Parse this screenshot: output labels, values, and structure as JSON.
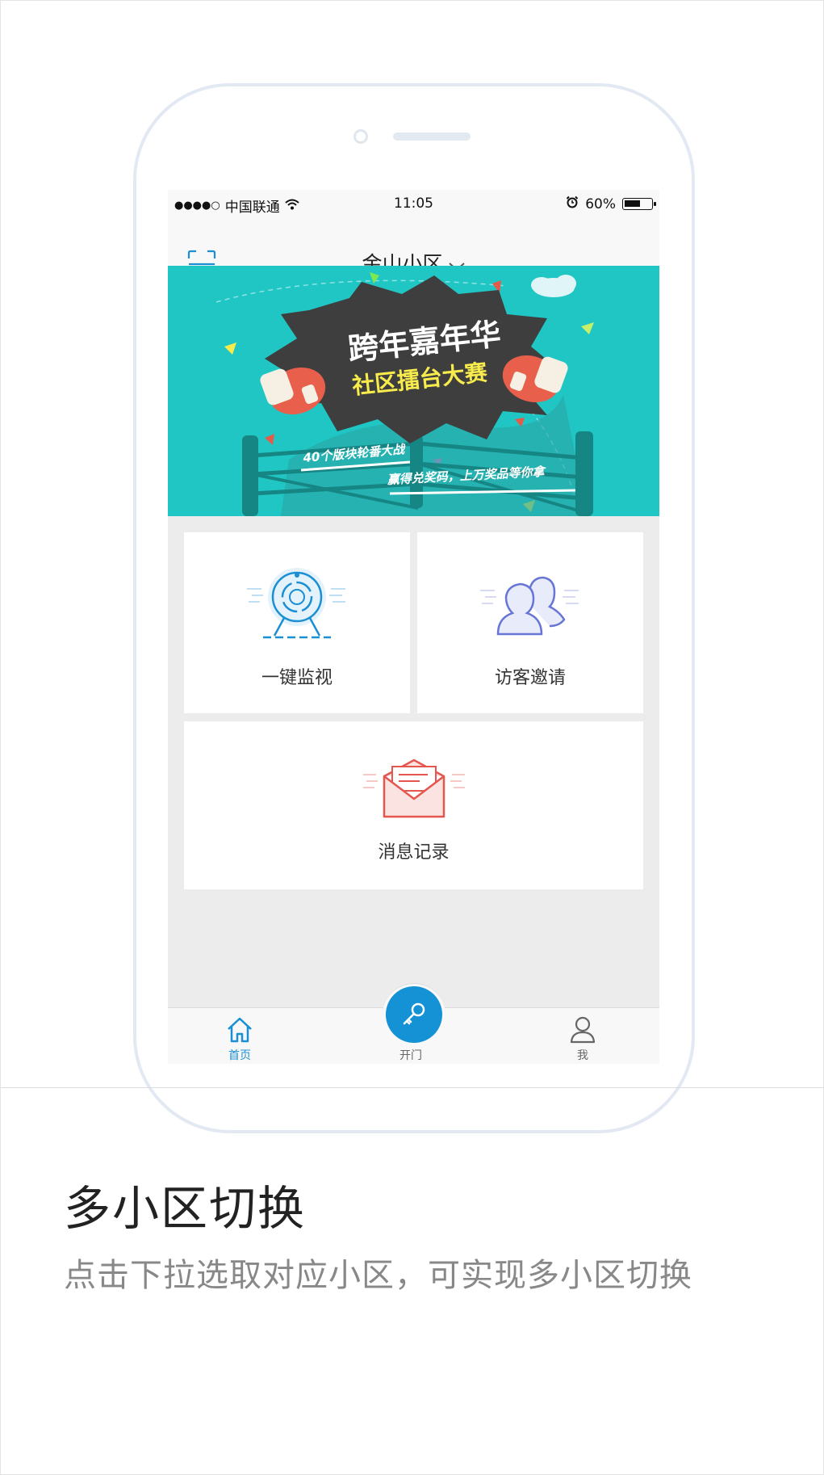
{
  "statusbar": {
    "signal": "●●●●○",
    "carrier": "中国联通",
    "time": "11:05",
    "battery_text": "60%",
    "battery_level": 0.6
  },
  "navbar": {
    "community": "金山小区"
  },
  "banner": {
    "title_line1": "跨年嘉年华",
    "title_line2": "社区擂台大赛",
    "tagline1": "40个版块轮番大战",
    "tagline2": "赢得兑奖码，上万奖品等你拿"
  },
  "tiles": {
    "monitor": "一键监视",
    "visitor": "访客邀请",
    "message": "消息记录"
  },
  "tabbar": {
    "home": "首页",
    "door": "开门",
    "me": "我"
  },
  "caption": {
    "title": "多小区切换",
    "subtitle": "点击下拉选取对应小区，可实现多小区切换"
  },
  "colors": {
    "accent": "#1592d6",
    "banner_bg": "#1fc6c4",
    "visitor_icon": "#6675d6",
    "message_icon": "#e5564f"
  }
}
